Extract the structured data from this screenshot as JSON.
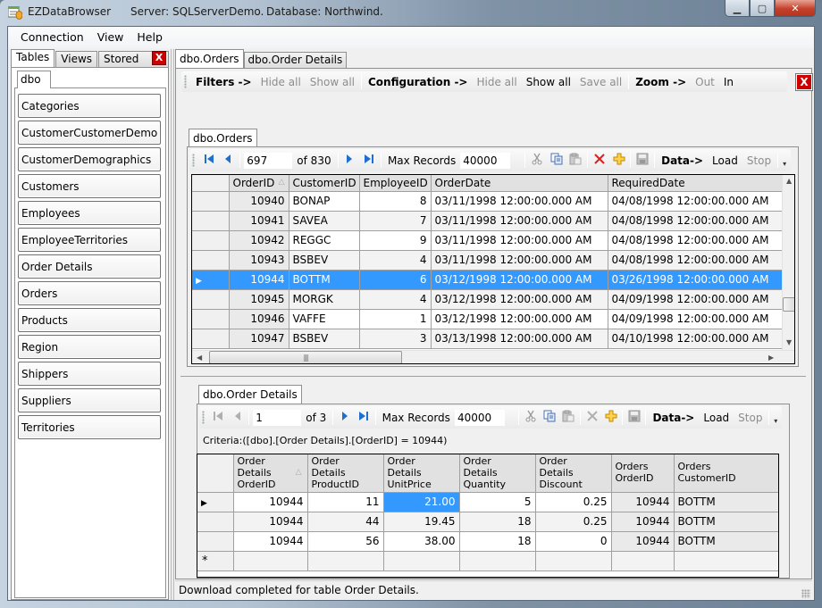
{
  "window": {
    "app_name": "EZDataBrowser",
    "server": "Server: SQLServerDemo.",
    "database": "Database: Northwind."
  },
  "menu": [
    "Connection",
    "View",
    "Help"
  ],
  "left_panel": {
    "tabs": [
      "Tables",
      "Views",
      "Stored Proc."
    ],
    "active_tab": "Tables",
    "schema_tab": "dbo",
    "tables": [
      "Categories",
      "CustomerCustomerDemo",
      "CustomerDemographics",
      "Customers",
      "Employees",
      "EmployeeTerritories",
      "Order Details",
      "Orders",
      "Products",
      "Region",
      "Shippers",
      "Suppliers",
      "Territories"
    ]
  },
  "right_tabs": [
    "dbo.Orders",
    "dbo.Order Details"
  ],
  "active_right_tab": "dbo.Orders",
  "config_toolbar": {
    "filters_label": "Filters ->",
    "filters_hide": "Hide all",
    "filters_show": "Show all",
    "config_label": "Configuration ->",
    "config_hide": "Hide all",
    "config_show": "Show all",
    "config_save": "Save all",
    "zoom_label": "Zoom ->",
    "zoom_out": "Out",
    "zoom_in": "In",
    "close": "X"
  },
  "orders_panel": {
    "tab": "dbo.Orders",
    "nav": {
      "position": "697",
      "of_label": "of 830",
      "max_records_label": "Max Records",
      "max_records_value": "40000",
      "data_label": "Data->",
      "load": "Load",
      "stop": "Stop"
    },
    "columns": [
      "OrderID",
      "CustomerID",
      "EmployeeID",
      "OrderDate",
      "RequiredDate"
    ],
    "rows": [
      {
        "OrderID": "10940",
        "CustomerID": "BONAP",
        "EmployeeID": "8",
        "OrderDate": "03/11/1998 12:00:00.000 AM",
        "RequiredDate": "04/08/1998 12:00:00.000 AM"
      },
      {
        "OrderID": "10941",
        "CustomerID": "SAVEA",
        "EmployeeID": "7",
        "OrderDate": "03/11/1998 12:00:00.000 AM",
        "RequiredDate": "04/08/1998 12:00:00.000 AM"
      },
      {
        "OrderID": "10942",
        "CustomerID": "REGGC",
        "EmployeeID": "9",
        "OrderDate": "03/11/1998 12:00:00.000 AM",
        "RequiredDate": "04/08/1998 12:00:00.000 AM"
      },
      {
        "OrderID": "10943",
        "CustomerID": "BSBEV",
        "EmployeeID": "4",
        "OrderDate": "03/11/1998 12:00:00.000 AM",
        "RequiredDate": "04/08/1998 12:00:00.000 AM"
      },
      {
        "OrderID": "10944",
        "CustomerID": "BOTTM",
        "EmployeeID": "6",
        "OrderDate": "03/12/1998 12:00:00.000 AM",
        "RequiredDate": "03/26/1998 12:00:00.000 AM"
      },
      {
        "OrderID": "10945",
        "CustomerID": "MORGK",
        "EmployeeID": "4",
        "OrderDate": "03/12/1998 12:00:00.000 AM",
        "RequiredDate": "04/09/1998 12:00:00.000 AM"
      },
      {
        "OrderID": "10946",
        "CustomerID": "VAFFE",
        "EmployeeID": "1",
        "OrderDate": "03/12/1998 12:00:00.000 AM",
        "RequiredDate": "04/09/1998 12:00:00.000 AM"
      },
      {
        "OrderID": "10947",
        "CustomerID": "BSBEV",
        "EmployeeID": "3",
        "OrderDate": "03/13/1998 12:00:00.000 AM",
        "RequiredDate": "04/10/1998 12:00:00.000 AM"
      }
    ],
    "selected_index": 4
  },
  "details_panel": {
    "tab": "dbo.Order Details",
    "nav": {
      "position": "1",
      "of_label": "of 3",
      "max_records_label": "Max Records",
      "max_records_value": "40000",
      "data_label": "Data->",
      "load": "Load",
      "stop": "Stop"
    },
    "criteria": "Criteria:([dbo].[Order Details].[OrderID] = 10944)",
    "columns": [
      [
        "Order",
        "Details",
        "OrderID"
      ],
      [
        "Order",
        "Details",
        "ProductID"
      ],
      [
        "Order",
        "Details",
        "UnitPrice"
      ],
      [
        "Order",
        "Details",
        "Quantity"
      ],
      [
        "Order",
        "Details",
        "Discount"
      ],
      [
        "Orders",
        "OrderID"
      ],
      [
        "Orders",
        "CustomerID"
      ]
    ],
    "rows": [
      [
        "10944",
        "11",
        "21.00",
        "5",
        "0.25",
        "10944",
        "BOTTM"
      ],
      [
        "10944",
        "44",
        "19.45",
        "18",
        "0.25",
        "10944",
        "BOTTM"
      ],
      [
        "10944",
        "56",
        "38.00",
        "18",
        "0",
        "10944",
        "BOTTM"
      ]
    ],
    "new_row_marker": "*"
  },
  "status": "Download completed for table Order Details.",
  "colors": {
    "selection": "#3399ff",
    "close_red": "#cc0000"
  }
}
